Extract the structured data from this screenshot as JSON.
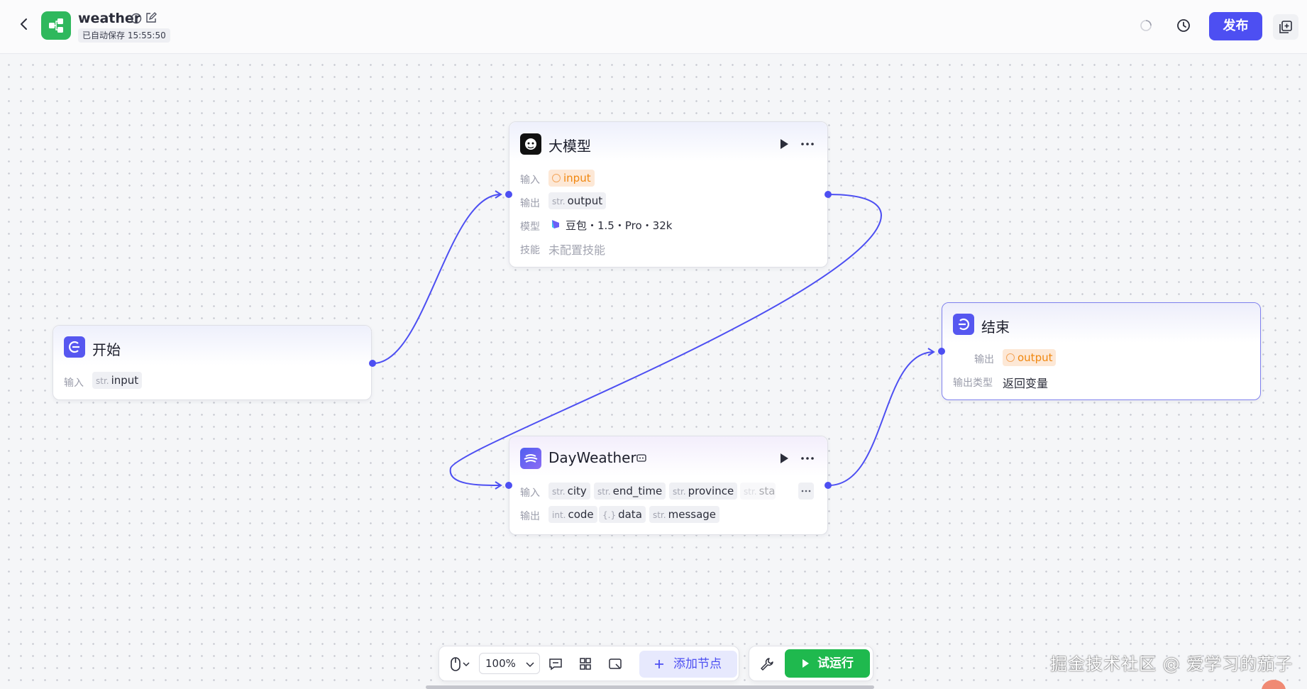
{
  "header": {
    "app_name": "weather",
    "autosave": "已自动保存 15:55:50",
    "publish_label": "发布"
  },
  "nodes": {
    "llm": {
      "title": "大模型",
      "input_label": "输入",
      "input_value": "input",
      "output_label": "输出",
      "output_type": "str.",
      "output_value": "output",
      "model_label": "模型",
      "model_value": "豆包・1.5・Pro・32k",
      "skill_label": "技能",
      "skill_value": "未配置技能"
    },
    "start": {
      "title": "开始",
      "input_label": "输入",
      "input_type": "str.",
      "input_value": "input"
    },
    "end": {
      "title": "结束",
      "output_label": "输出",
      "output_value": "output",
      "output_type_label": "输出类型",
      "output_type_value": "返回变量"
    },
    "dayweather": {
      "title": "DayWeather",
      "input_label": "输入",
      "inputs": [
        {
          "type": "str.",
          "name": "city"
        },
        {
          "type": "str.",
          "name": "end_time"
        },
        {
          "type": "str.",
          "name": "province"
        },
        {
          "type": "str.",
          "name": "sta"
        }
      ],
      "output_label": "输出",
      "outputs": [
        {
          "type": "int.",
          "name": "code"
        },
        {
          "type": "{.}",
          "name": "data"
        },
        {
          "type": "str.",
          "name": "message"
        }
      ]
    }
  },
  "toolbar": {
    "zoom": "100%",
    "add_node_label": "添加节点",
    "test_run_label": "试运行"
  },
  "watermark": "掘金技术社区 @ 爱学习的茄子",
  "colors": {
    "accent": "#4d4ff2",
    "green": "#1fb94e",
    "warn": "#f0870f"
  }
}
